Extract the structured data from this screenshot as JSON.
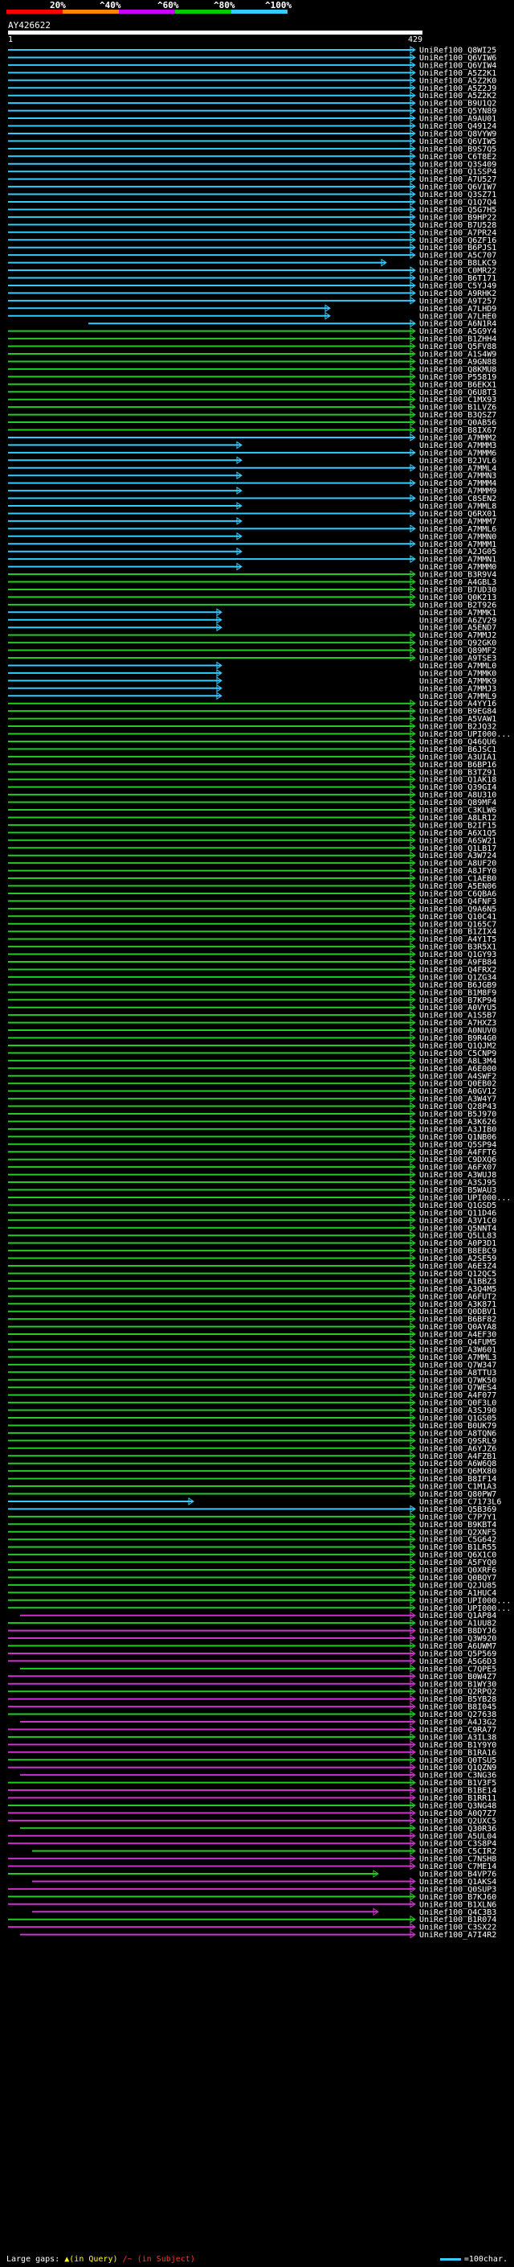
{
  "query": {
    "id": "AY426622",
    "start": "1",
    "end": "429"
  },
  "legend": [
    {
      "label": "20%",
      "color": "#ff0000"
    },
    {
      "label": "^40%",
      "color": "#ff8800"
    },
    {
      "label": "^60%",
      "color": "#cc00ff"
    },
    {
      "label": "^80%",
      "color": "#00cc00"
    },
    {
      "label": "^100%",
      "color": "#33ccff"
    }
  ],
  "colors": {
    "cyan": "#33ccff",
    "green": "#22cc22",
    "magenta": "#cc33cc"
  },
  "footer": {
    "text": "Large gaps:",
    "gap_query": "▲(in Query)",
    "gap_subject": "/~ (in Subject)",
    "scale": "=100char."
  },
  "hits": [
    "UniRef100_Q8WI25",
    "UniRef100_Q6VIW6",
    "UniRef100_Q6VIW4",
    "UniRef100_A5Z2K1",
    "UniRef100_A5Z2K0",
    "UniRef100_A5Z2J9",
    "UniRef100_A5Z2K2",
    "UniRef100_B9U1Q2",
    "UniRef100_Q5YN89",
    "UniRef100_A9AU01",
    "UniRef100_Q49124",
    "UniRef100_Q8VYW9",
    "UniRef100_Q6VIW5",
    "UniRef100_B9S7Q5",
    "UniRef100_C6T8E2",
    "UniRef100_Q3S409",
    "UniRef100_Q1SSP4",
    "UniRef100_A7U527",
    "UniRef100_Q6VIW7",
    "UniRef100_Q3SZ71",
    "UniRef100_Q1Q7Q4",
    "UniRef100_Q5G7H5",
    "UniRef100_B9HP22",
    "UniRef100_B7U528",
    "UniRef100_A7PR24",
    "UniRef100_Q6ZF16",
    "UniRef100_B6PJS1",
    "UniRef100_A5C707",
    "UniRef100_B8LKC9",
    "UniRef100_C0MR22",
    "UniRef100_B6T171",
    "UniRef100_C5YJ49",
    "UniRef100_A9RHK2",
    "UniRef100_A9T257",
    "UniRef100_A7LHD9",
    "UniRef100_A7LHE0",
    "UniRef100_A6N1R4",
    "UniRef100_A5G9Y4",
    "UniRef100_B1ZHH4",
    "UniRef100_Q5FV88",
    "UniRef100_A1S4W9",
    "UniRef100_A9GN88",
    "UniRef100_Q8KMU8",
    "UniRef100_P55819",
    "UniRef100_B6EKX1",
    "UniRef100_Q6U8T3",
    "UniRef100_C1MX93",
    "UniRef100_B1LVZ6",
    "UniRef100_B3QSZ7",
    "UniRef100_Q0AB56",
    "UniRef100_B8IX67",
    "UniRef100_A7MMM2",
    "UniRef100_A7MMM3",
    "UniRef100_A7MMM6",
    "UniRef100_B2JVL6",
    "UniRef100_A7MML4",
    "UniRef100_A7MMN3",
    "UniRef100_A7MMM4",
    "UniRef100_A7MMM9",
    "UniRef100_C8SEN2",
    "UniRef100_A7MML8",
    "UniRef100_Q6RX01",
    "UniRef100_A7MMM7",
    "UniRef100_A7MML6",
    "UniRef100_A7MMN0",
    "UniRef100_A7MMM1",
    "UniRef100_A2JG05",
    "UniRef100_A7MMN1",
    "UniRef100_A7MMM0",
    "UniRef100_B3R9V4",
    "UniRef100_A4GBL3",
    "UniRef100_B7UD30",
    "UniRef100_Q0K213",
    "UniRef100_B2T926",
    "UniRef100_A7MMK1",
    "UniRef100_A6ZV29",
    "UniRef100_A5END7",
    "UniRef100_A7MMJ2",
    "UniRef100_Q92GK0",
    "UniRef100_Q89MF2",
    "UniRef100_A9TSE3",
    "UniRef100_A7MML0",
    "UniRef100_A7MMK0",
    "UniRef100_A7MMK9",
    "UniRef100_A7MMJ3",
    "UniRef100_A7MML9",
    "UniRef100_A4YY16",
    "UniRef100_B9EG84",
    "UniRef100_A5VAW1",
    "UniRef100_B2JQ32",
    "UniRef100_UPI000...",
    "UniRef100_Q46QU6",
    "UniRef100_B6JSC1",
    "UniRef100_A3UIA1",
    "UniRef100_B6BP16",
    "UniRef100_B3TZ91",
    "UniRef100_Q1AK18",
    "UniRef100_Q39GI4",
    "UniRef100_A8U310",
    "UniRef100_Q89MF4",
    "UniRef100_C3KLW6",
    "UniRef100_A8LR12",
    "UniRef100_B2IF15",
    "UniRef100_A6X1Q5",
    "UniRef100_A6SW21",
    "UniRef100_Q1LB17",
    "UniRef100_A3W724",
    "UniRef100_A8UF20",
    "UniRef100_A8JFY0",
    "UniRef100_C1AEB0",
    "UniRef100_A5EN06",
    "UniRef100_C6QBA6",
    "UniRef100_Q4FNF3",
    "UniRef100_Q9A6N5",
    "UniRef100_Q10C41",
    "UniRef100_Q165C7",
    "UniRef100_B1ZIX4",
    "UniRef100_A4Y1T5",
    "UniRef100_B3R5X1",
    "UniRef100_Q1GY93",
    "UniRef100_A9FB84",
    "UniRef100_Q4FRX2",
    "UniRef100_Q1ZG34",
    "UniRef100_B6JGB9",
    "UniRef100_B1M8F9",
    "UniRef100_B7KP94",
    "UniRef100_A0VYU5",
    "UniRef100_A1S5B7",
    "UniRef100_A7HXZ3",
    "UniRef100_A0NUV0",
    "UniRef100_B9R4G0",
    "UniRef100_Q1QJM2",
    "UniRef100_C5CNP9",
    "UniRef100_A8L3M4",
    "UniRef100_A6E000",
    "UniRef100_A4SWF2",
    "UniRef100_Q0EB02",
    "UniRef100_A0GV12",
    "UniRef100_A3W4Y7",
    "UniRef100_Q28P43",
    "UniRef100_B5J970",
    "UniRef100_A3K626",
    "UniRef100_A3JIB0",
    "UniRef100_Q1NB06",
    "UniRef100_Q5SP94",
    "UniRef100_A4FFT6",
    "UniRef100_C9DXQ6",
    "UniRef100_A6FX07",
    "UniRef100_A3WUJ8",
    "UniRef100_A3SJ95",
    "UniRef100_B5WAU3",
    "UniRef100_UPI000...",
    "UniRef100_Q1GSD5",
    "UniRef100_Q11D46",
    "UniRef100_A3V1C0",
    "UniRef100_Q5NNT4",
    "UniRef100_Q5LL83",
    "UniRef100_A0P3D1",
    "UniRef100_B8EBC9",
    "UniRef100_A2SE59",
    "UniRef100_A6E3Z4",
    "UniRef100_Q12QC5",
    "UniRef100_A1BBZ3",
    "UniRef100_A3Q4M5",
    "UniRef100_A6FUT2",
    "UniRef100_A3K871",
    "UniRef100_Q0DBV1",
    "UniRef100_B6BF82",
    "UniRef100_Q0AYA8",
    "UniRef100_A4EF30",
    "UniRef100_Q4FUM5",
    "UniRef100_A3W601",
    "UniRef100_A7MML3",
    "UniRef100_Q7W347",
    "UniRef100_A8TTU3",
    "UniRef100_Q7WK50",
    "UniRef100_Q7WES4",
    "UniRef100_A4F077",
    "UniRef100_Q0F3L0",
    "UniRef100_A3SJ90",
    "UniRef100_Q1GS05",
    "UniRef100_B0UK79",
    "UniRef100_A8TQN6",
    "UniRef100_Q9SRL9",
    "UniRef100_A6YJZ6",
    "UniRef100_A4FZB1",
    "UniRef100_A6W6Q8",
    "UniRef100_Q6MX80",
    "UniRef100_B8IF14",
    "UniRef100_C1M1A3",
    "UniRef100_Q80PW7",
    "UniRef100_C7173L6",
    "UniRef100_Q5B369",
    "UniRef100_C7P7Y1",
    "UniRef100_B9KBT4",
    "UniRef100_Q2XNF5",
    "UniRef100_C5G642",
    "UniRef100_B1LR55",
    "UniRef100_Q6X1C0",
    "UniRef100_A5FYQ0",
    "UniRef100_Q0XRF6",
    "UniRef100_Q0BQY7",
    "UniRef100_Q2JU85",
    "UniRef100_A1HUC4",
    "UniRef100_UPI000...",
    "UniRef100_UPI000...",
    "UniRef100_Q1AP84",
    "UniRef100_A1UU82",
    "UniRef100_B8DYJ6",
    "UniRef100_Q3W920",
    "UniRef100_A6UWM7",
    "UniRef100_Q5P569",
    "UniRef100_A5G6D3",
    "UniRef100_C7QPE5",
    "UniRef100_B0W4Z7",
    "UniRef100_B1WY30",
    "UniRef100_Q2RPQ2",
    "UniRef100_B5YB28",
    "UniRef100_B8I045",
    "UniRef100_Q27638",
    "UniRef100_A4J3G2",
    "UniRef100_C9RA77",
    "UniRef100_A3IL38",
    "UniRef100_B1Y9Y0",
    "UniRef100_B1RA16",
    "UniRef100_Q0TSU5",
    "UniRef100_Q1QZN9",
    "UniRef100_C3NG36",
    "UniRef100_B1V3F5",
    "UniRef100_B1BE14",
    "UniRef100_B1RR11",
    "UniRef100_Q3NG48",
    "UniRef100_A0Q7Z7",
    "UniRef100_Q2UXC5",
    "UniRef100_Q30R36",
    "UniRef100_A5UL04",
    "UniRef100_C3S8P4",
    "UniRef100_C5CIR2",
    "UniRef100_C7NSH8",
    "UniRef100_C7ME14",
    "UniRef100_B4VP76",
    "UniRef100_Q1AKS4",
    "UniRef100_Q0SUP3",
    "UniRef100_B7KJ60",
    "UniRef100_B1XLN6",
    "UniRef100_Q4C3B3",
    "UniRef100_B1R074",
    "UniRef100_C3SX22",
    "UniRef100_A7I4R2"
  ]
}
